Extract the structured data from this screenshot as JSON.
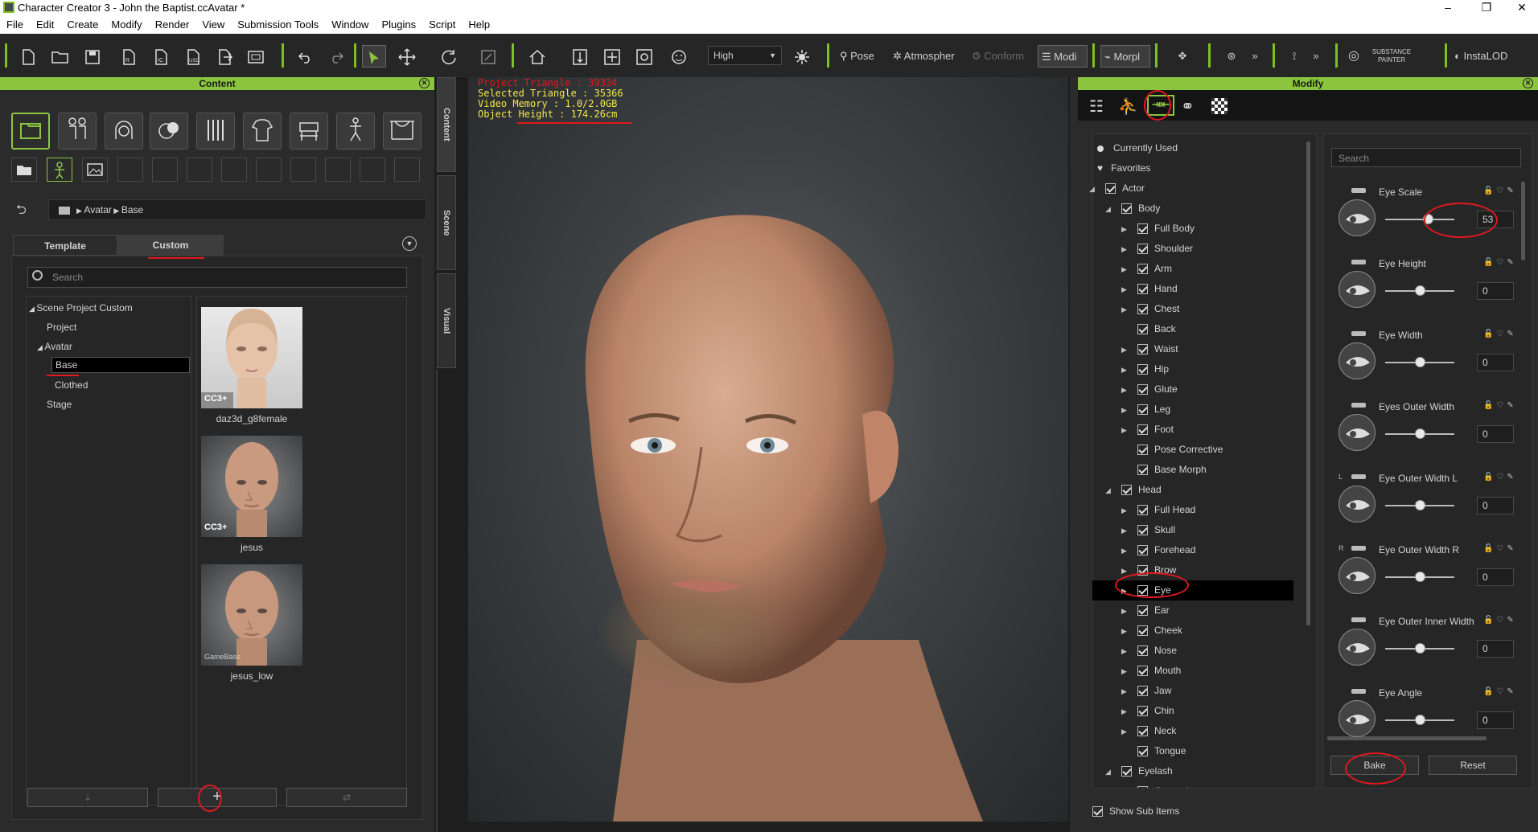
{
  "window": {
    "title": "Character Creator 3 - John the Baptist.ccAvatar *",
    "controls": [
      "–",
      "❐",
      "✕"
    ]
  },
  "menu": [
    "File",
    "Edit",
    "Create",
    "Modify",
    "Render",
    "View",
    "Submission Tools",
    "Window",
    "Plugins",
    "Script",
    "Help"
  ],
  "toolbar": {
    "quality": "High",
    "pose_label": "Pose",
    "atmosphere_label": "Atmospher",
    "conform_label": "Conform",
    "modify_label": "Modi",
    "morph_label": "Morpl",
    "substance_label": "SUBSTANCE PAINTER",
    "instalod_label": "InstaLOD"
  },
  "content_panel": {
    "title": "Content",
    "breadcrumb": [
      "Avatar",
      "Base"
    ],
    "tabs": [
      "Template",
      "Custom"
    ],
    "search_placeholder": "Search",
    "tree": [
      {
        "label": "Scene Project Custom",
        "level": 0,
        "expanded": true
      },
      {
        "label": "Project",
        "level": 1
      },
      {
        "label": "Avatar",
        "level": 1,
        "expanded": true
      },
      {
        "label": "Base",
        "level": 2,
        "selected": true
      },
      {
        "label": "Clothed",
        "level": 2
      },
      {
        "label": "Stage",
        "level": 1
      }
    ],
    "items": [
      {
        "name": "daz3d_g8female",
        "badge": "CC3+"
      },
      {
        "name": "jesus",
        "badge": "CC3+"
      },
      {
        "name": "jesus_low",
        "badge": "GameBase"
      }
    ]
  },
  "side_tabs": [
    "Content",
    "Scene",
    "Visual"
  ],
  "viewport": {
    "stats": [
      {
        "label": "Project Triangle : 39334",
        "color": "#e0191f"
      },
      {
        "label": "Selected Triangle : 35366",
        "color": "#f2e64b"
      },
      {
        "label": "Video Memory : 1.0/2.0GB",
        "color": "#f2e64b"
      },
      {
        "label": "Object Height : 174.26cm",
        "color": "#f2e64b"
      }
    ]
  },
  "modify_panel": {
    "title": "Modify",
    "search_placeholder": "Search",
    "tree": [
      {
        "label": "Currently Used",
        "type": "bullet",
        "level": 0
      },
      {
        "label": "Favorites",
        "type": "heart",
        "level": 0
      },
      {
        "label": "Actor",
        "level": 0,
        "expand": "open"
      },
      {
        "label": "Body",
        "level": 1,
        "expand": "open"
      },
      {
        "label": "Full Body",
        "level": 2,
        "expand": "closed"
      },
      {
        "label": "Shoulder",
        "level": 2,
        "expand": "closed"
      },
      {
        "label": "Arm",
        "level": 2,
        "expand": "closed"
      },
      {
        "label": "Hand",
        "level": 2,
        "expand": "closed"
      },
      {
        "label": "Chest",
        "level": 2,
        "expand": "closed"
      },
      {
        "label": "Back",
        "level": 2,
        "expand": "none"
      },
      {
        "label": "Waist",
        "level": 2,
        "expand": "closed"
      },
      {
        "label": "Hip",
        "level": 2,
        "expand": "closed"
      },
      {
        "label": "Glute",
        "level": 2,
        "expand": "closed"
      },
      {
        "label": "Leg",
        "level": 2,
        "expand": "closed"
      },
      {
        "label": "Foot",
        "level": 2,
        "expand": "closed"
      },
      {
        "label": "Pose Corrective",
        "level": 2,
        "expand": "none"
      },
      {
        "label": "Base Morph",
        "level": 2,
        "expand": "none"
      },
      {
        "label": "Head",
        "level": 1,
        "expand": "open"
      },
      {
        "label": "Full Head",
        "level": 2,
        "expand": "closed"
      },
      {
        "label": "Skull",
        "level": 2,
        "expand": "closed"
      },
      {
        "label": "Forehead",
        "level": 2,
        "expand": "closed"
      },
      {
        "label": "Brow",
        "level": 2,
        "expand": "closed"
      },
      {
        "label": "Eye",
        "level": 2,
        "expand": "closed",
        "selected": true
      },
      {
        "label": "Ear",
        "level": 2,
        "expand": "closed"
      },
      {
        "label": "Cheek",
        "level": 2,
        "expand": "closed"
      },
      {
        "label": "Nose",
        "level": 2,
        "expand": "closed"
      },
      {
        "label": "Mouth",
        "level": 2,
        "expand": "closed"
      },
      {
        "label": "Jaw",
        "level": 2,
        "expand": "closed"
      },
      {
        "label": "Chin",
        "level": 2,
        "expand": "closed"
      },
      {
        "label": "Neck",
        "level": 2,
        "expand": "closed"
      },
      {
        "label": "Tongue",
        "level": 2,
        "expand": "none"
      },
      {
        "label": "Eyelash",
        "level": 1,
        "expand": "open"
      },
      {
        "label": "General",
        "level": 2,
        "expand": "none"
      }
    ],
    "sliders": [
      {
        "label": "Eye Scale",
        "value": "53",
        "prefix": ""
      },
      {
        "label": "Eye Height",
        "value": "0",
        "prefix": ""
      },
      {
        "label": "Eye Width",
        "value": "0",
        "prefix": ""
      },
      {
        "label": "Eyes Outer Width",
        "value": "0",
        "prefix": ""
      },
      {
        "label": "Eye Outer Width L",
        "value": "0",
        "prefix": "L"
      },
      {
        "label": "Eye Outer Width R",
        "value": "0",
        "prefix": "R"
      },
      {
        "label": "Eye Outer Inner Width",
        "value": "0",
        "prefix": ""
      },
      {
        "label": "Eye Angle",
        "value": "0",
        "prefix": ""
      }
    ],
    "slider_fraction": [
      0.62,
      0.5,
      0.5,
      0.5,
      0.5,
      0.5,
      0.5,
      0.5
    ],
    "bake_label": "Bake",
    "reset_label": "Reset",
    "show_sub_items": "Show Sub Items"
  }
}
